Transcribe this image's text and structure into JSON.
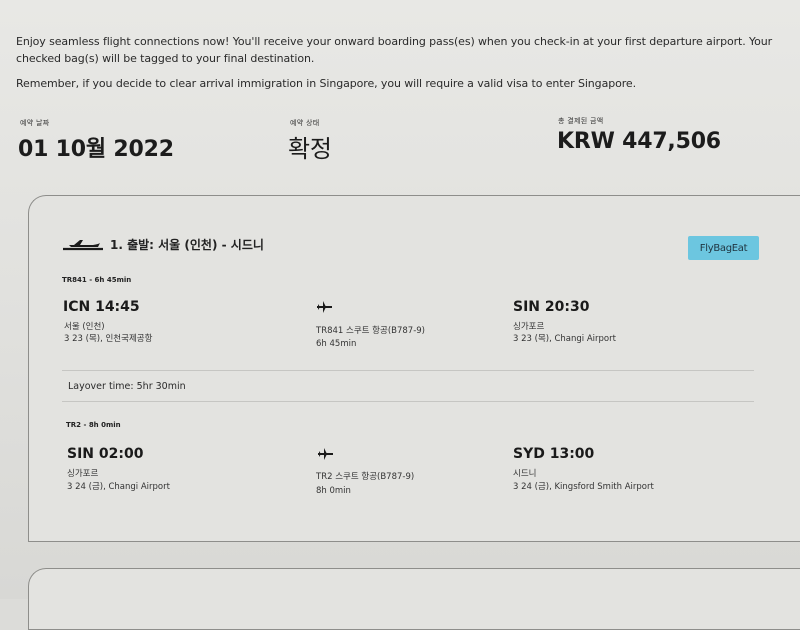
{
  "notice": {
    "line1": "Enjoy seamless flight connections now! You'll receive your onward boarding pass(es) when you check-in at your first departure airport. Your checked bag(s) will be tagged to your final destination.",
    "line2": "Remember, if you decide to clear arrival immigration in Singapore, you will require a valid visa to enter Singapore."
  },
  "summary": {
    "booking_date_label": "예약 날짜",
    "booking_date_value": "01 10월 2022",
    "booking_status_label": "예약 상태",
    "booking_status_value": "확정",
    "total_paid_label": "총 결제된 금액",
    "total_paid_value": "KRW 447,506"
  },
  "route": {
    "title": "1. 출발: 서울 (인천) - 시드니",
    "badge": "FlyBagEat",
    "icon": "takeoff-plane-icon"
  },
  "segments": [
    {
      "code_duration": "TR841 - 6h 45min",
      "departure_time": "ICN 14:45",
      "departure_city": "서울 (인천)",
      "departure_date_airport": "3 23 (목), 인천국제공항",
      "flight_info": "TR841 스쿠트 항공(B787-9)",
      "duration": "6h 45min",
      "arrival_time": "SIN 20:30",
      "arrival_city": "싱가포르",
      "arrival_date_airport": "3 23 (목), Changi Airport"
    },
    {
      "code_duration": "TR2 - 8h 0min",
      "departure_time": "SIN 02:00",
      "departure_city": "싱가포르",
      "departure_date_airport": "3 24 (금), Changi Airport",
      "flight_info": "TR2 스쿠트 항공(B787-9)",
      "duration": "8h 0min",
      "arrival_time": "SYD 13:00",
      "arrival_city": "시드니",
      "arrival_date_airport": "3 24 (금), Kingsford Smith Airport"
    }
  ],
  "layover": "Layover time: 5hr 30min"
}
